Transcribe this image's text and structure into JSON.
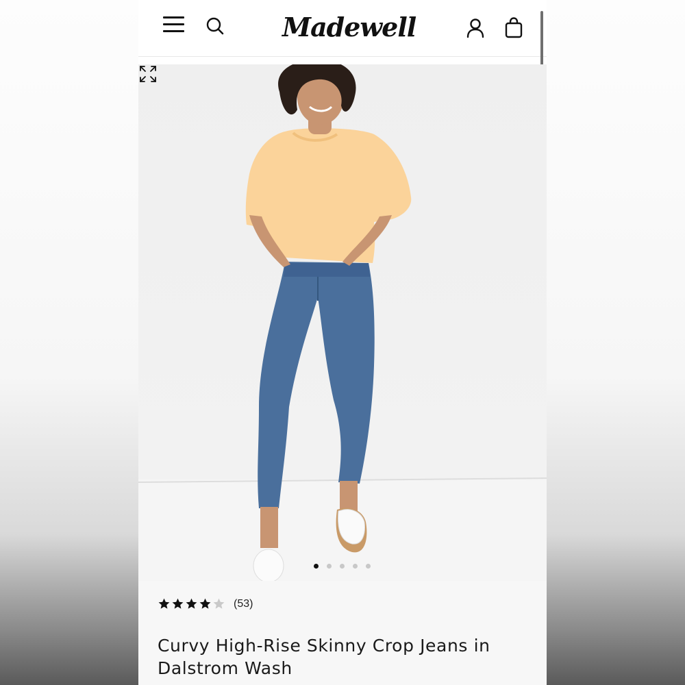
{
  "header": {
    "brand": "Madewell",
    "icons": [
      "menu-icon",
      "search-icon",
      "account-icon",
      "bag-icon"
    ]
  },
  "gallery": {
    "image_count": 5,
    "active_index": 0,
    "expand_icon": "expand-icon"
  },
  "product": {
    "rating": 4,
    "max_rating": 5,
    "review_count": "(53)",
    "title": "Curvy High-Rise Skinny Crop Jeans in Dalstrom Wash"
  },
  "colors": {
    "text": "#111111",
    "star_filled": "#111111",
    "star_empty": "#c9c9c9",
    "sweatshirt": "#fbd39a",
    "denim": "#4a6f9c"
  }
}
